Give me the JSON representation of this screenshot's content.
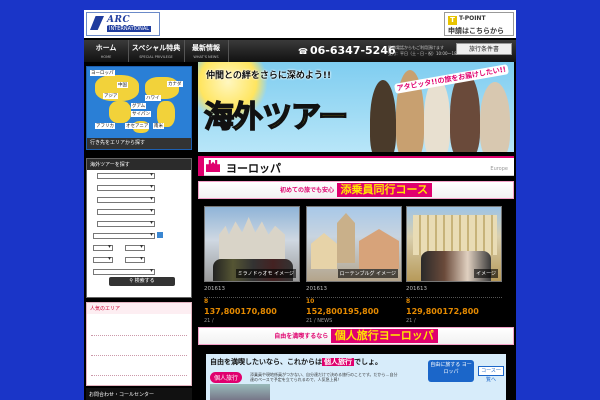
{
  "header": {
    "logo_name": "ARC TRIP",
    "logo_sub": "INTERNATIONAL",
    "tpoint_line1": "T-POINT",
    "tpoint_line2": "申請はこちらから"
  },
  "nav": {
    "items": [
      {
        "label": "ホーム",
        "sub": "HOME"
      },
      {
        "label": "スペシャル特典",
        "sub": "SPECIAL PRIVILEGE"
      },
      {
        "label": "最新情報",
        "sub": "WHAT'S NEWS"
      }
    ],
    "phone": "06-6347-5246",
    "hours_line1": "携帯電話からもご利用頂けます",
    "hours_line2": "受付：平日（土・日・祝）10:00～18:00",
    "request_button": "旅行条件書"
  },
  "sidebar": {
    "map_labels": [
      "ヨーロッパ",
      "中国",
      "アジア",
      "ハワイ",
      "グアム",
      "サイパン",
      "カナダ",
      "オセアニア",
      "アフリカ",
      "南米"
    ],
    "map_caption": "行き先をエリアから探す",
    "search_title": "海外ツアーを探す",
    "search_button": "検索する",
    "area_title": "人気のエリア",
    "call_center": "お問合わせ・コールセンター"
  },
  "banner": {
    "line1": "仲間との絆をさらに深めよう!!",
    "line2": "海外ツアー",
    "line3": "アタビッタ!!の旅をお届けしたい!!"
  },
  "section": {
    "title": "ヨーロッパ",
    "en": "Europe",
    "ribbon1_small": "初めての旅でも安心",
    "ribbon1_big": "添乗員同行コース",
    "ribbon2_small": "自由を満喫するなら",
    "ribbon2_big": "個人旅行ヨーロッパ"
  },
  "tours": [
    {
      "caption": "ミラノドゥオモ イメージ",
      "date": "201613",
      "num": "8",
      "price": "137,800170,800",
      "meta": "21 /"
    },
    {
      "caption": "ローテンブルグ イメージ",
      "date": "201613",
      "num": "10",
      "price": "152,800195,800",
      "meta": "21 / NEWS"
    },
    {
      "caption": "イメージ",
      "date": "201613",
      "num": "8",
      "price": "129,800172,800",
      "meta": "21 /"
    }
  ],
  "individual": {
    "lead_before": "自由を満喫したいなら、これからは",
    "lead_highlight": "個人旅行",
    "lead_after": "でしょ。",
    "pill": "個人旅行",
    "desc": "添乗員や現地係員がつかない、自分達だけで決める旅行のことです。だから…自分達のペースで予定を立てられるので、人気急上昇！",
    "box": "自由に旅する ヨーロッパ",
    "list_button": "コース一覧へ"
  },
  "colors": {
    "background": "#1a35c8",
    "accent": "#e0006e",
    "price": "#e58a00",
    "banner_title": "#ffe500"
  }
}
